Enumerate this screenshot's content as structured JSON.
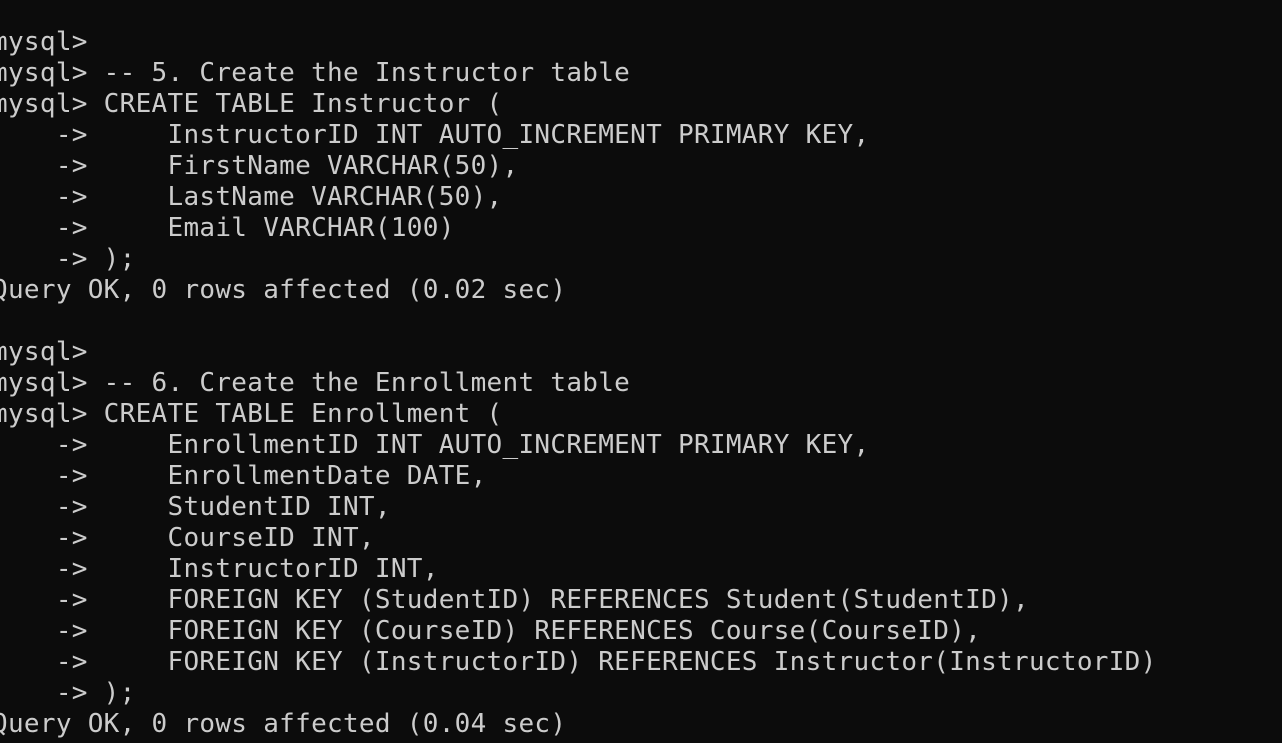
{
  "terminal": {
    "lines": [
      "mysql>",
      "mysql> -- 5. Create the Instructor table",
      "mysql> CREATE TABLE Instructor (",
      "    ->     InstructorID INT AUTO_INCREMENT PRIMARY KEY,",
      "    ->     FirstName VARCHAR(50),",
      "    ->     LastName VARCHAR(50),",
      "    ->     Email VARCHAR(100)",
      "    -> );",
      "Query OK, 0 rows affected (0.02 sec)",
      "",
      "mysql>",
      "mysql> -- 6. Create the Enrollment table",
      "mysql> CREATE TABLE Enrollment (",
      "    ->     EnrollmentID INT AUTO_INCREMENT PRIMARY KEY,",
      "    ->     EnrollmentDate DATE,",
      "    ->     StudentID INT,",
      "    ->     CourseID INT,",
      "    ->     InstructorID INT,",
      "    ->     FOREIGN KEY (StudentID) REFERENCES Student(StudentID),",
      "    ->     FOREIGN KEY (CourseID) REFERENCES Course(CourseID),",
      "    ->     FOREIGN KEY (InstructorID) REFERENCES Instructor(InstructorID)",
      "    -> );",
      "Query OK, 0 rows affected (0.04 sec)"
    ]
  }
}
